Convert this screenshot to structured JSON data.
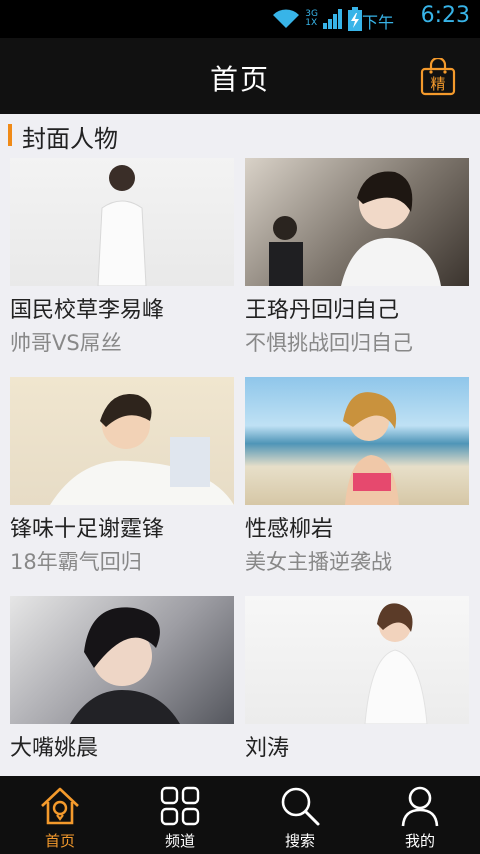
{
  "status_bar": {
    "network_type": "3G",
    "network_type_alt": "1X",
    "ampm": "下午",
    "time": "6:23"
  },
  "header": {
    "title": "首页",
    "featured_badge": "精"
  },
  "section": {
    "title": "封面人物"
  },
  "cards": [
    {
      "name": "国民校草李易峰",
      "subtitle": "帅哥VS屌丝"
    },
    {
      "name": "王珞丹回归自己",
      "subtitle": "不惧挑战回归自己"
    },
    {
      "name": "锋味十足谢霆锋",
      "subtitle": "18年霸气回归"
    },
    {
      "name": "性感柳岩",
      "subtitle": "美女主播逆袭战"
    },
    {
      "name": "大嘴姚晨",
      "subtitle": ""
    },
    {
      "name": "刘涛",
      "subtitle": ""
    }
  ],
  "bottom_nav": {
    "items": [
      {
        "label": "首页",
        "icon": "home-icon",
        "active": true
      },
      {
        "label": "频道",
        "icon": "grid-icon",
        "active": false
      },
      {
        "label": "搜索",
        "icon": "search-icon",
        "active": false
      },
      {
        "label": "我的",
        "icon": "user-icon",
        "active": false
      }
    ]
  },
  "colors": {
    "accent": "#f49a2c",
    "time_blue": "#38b4e8",
    "header_bg": "#111111",
    "page_bg": "#efeff3"
  }
}
